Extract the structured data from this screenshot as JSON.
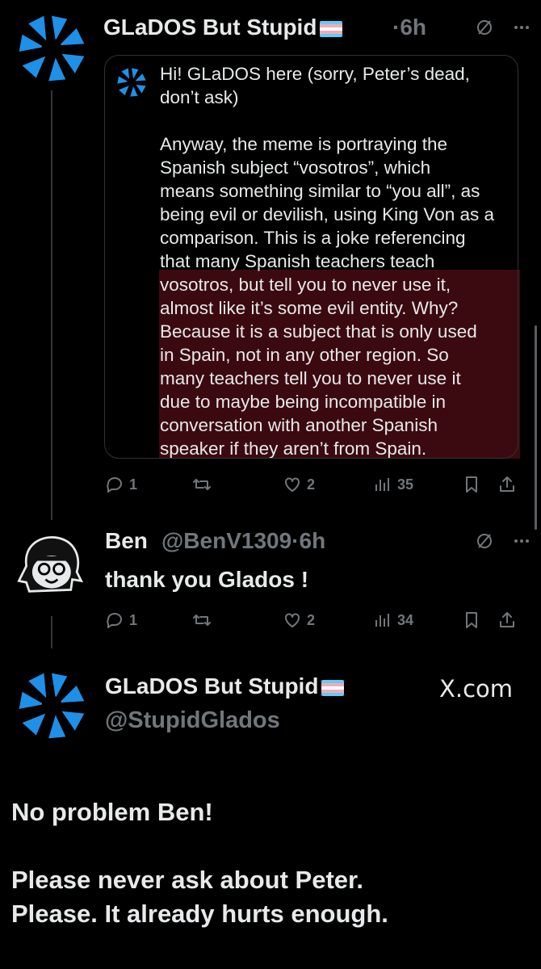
{
  "post1": {
    "display_name": "GLaDOS But Stupid",
    "time": "·6h",
    "quote": {
      "line1": "Hi!  GLaDOS here (sorry, Peter’s dead,",
      "line2": "don’t ask)",
      "body": "Anyway, the meme is portraying the\nSpanish subject “vosotros”, which\nmeans something similar to “you all”, as\nbeing evil or devilish, using King Von as a\ncomparison.  This is a joke referencing\nthat many Spanish teachers teach\nvosotros, but tell you to never use it,\nalmost like it’s some evil entity.  Why?\nBecause it is a subject that is only used\nin Spain, not in any other region.  So\nmany teachers tell you to never use it\ndue to maybe being incompatible in\nconversation with another Spanish\nspeaker if they aren’t from Spain."
    },
    "actions": {
      "replies": "1",
      "retweets": "",
      "likes": "2",
      "views": "35"
    }
  },
  "post2": {
    "display_name": "Ben",
    "handle": "@BenV1309",
    "time": "·6h",
    "text": "thank you Glados !",
    "actions": {
      "replies": "1",
      "retweets": "",
      "likes": "2",
      "views": "34"
    }
  },
  "post3": {
    "display_name": "GLaDOS But Stupid",
    "handle": "@StupidGlados",
    "source": "X.com",
    "text": "No problem Ben!\n\nPlease never ask about Peter.\nPlease.  It already hurts enough."
  },
  "icons": {
    "grok": "slashed-circle-icon",
    "more": "more-dots-icon",
    "reply": "reply-bubble-icon",
    "retweet": "retweet-icon",
    "like": "heart-icon",
    "views": "bar-chart-icon",
    "bookmark": "bookmark-icon",
    "share": "share-icon"
  },
  "colors": {
    "background": "#000000",
    "text": "#e7e9ea",
    "muted": "#71767b",
    "aperture_blue": "#1e90e8",
    "highlight": "#3b0a10"
  }
}
